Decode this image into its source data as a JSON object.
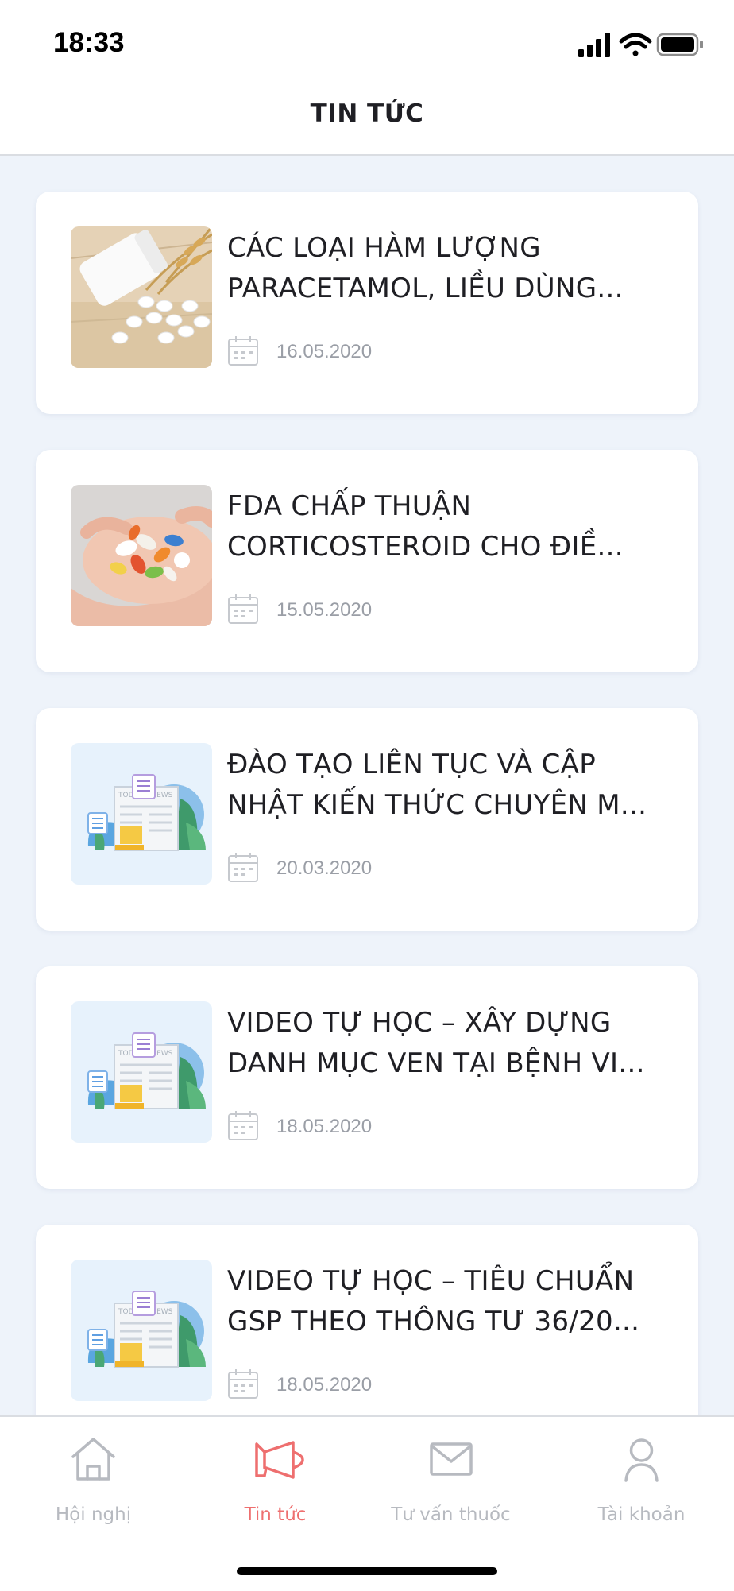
{
  "status_bar": {
    "time": "18:33"
  },
  "header": {
    "title": "TIN TỨC"
  },
  "news": [
    {
      "title_line1": "CÁC LOẠI HÀM LƯỢNG",
      "title_line2": "PARACETAMOL, LIỀU DÙNG...",
      "date": "16.05.2020",
      "thumbnail": "paracetamol-pills-photo"
    },
    {
      "title_line1": "FDA CHẤP THUẬN",
      "title_line2": "CORTICOSTEROID CHO ĐIỀ...",
      "date": "15.05.2020",
      "thumbnail": "hand-with-pills-photo"
    },
    {
      "title_line1": "ĐÀO TẠO LIÊN TỤC VÀ CẬP",
      "title_line2": "NHẬT KIẾN THỨC CHUYÊN M...",
      "date": "20.03.2020",
      "thumbnail": "newspaper-illustration"
    },
    {
      "title_line1": "VIDEO TỰ HỌC – XÂY DỰNG",
      "title_line2": "DANH MỤC VEN TẠI BỆNH VI...",
      "date": "18.05.2020",
      "thumbnail": "newspaper-illustration"
    },
    {
      "title_line1": "VIDEO TỰ HỌC – TIÊU CHUẨN",
      "title_line2": "GSP THEO THÔNG TƯ 36/20...",
      "date": "18.05.2020",
      "thumbnail": "newspaper-illustration"
    }
  ],
  "illustration_text": "TODAY'S NEWS",
  "tabs": [
    {
      "label": "Hội nghị",
      "icon": "home-icon",
      "active": false
    },
    {
      "label": "Tin tức",
      "icon": "megaphone-icon",
      "active": true
    },
    {
      "label": "Tư vấn thuốc",
      "icon": "envelope-icon",
      "active": false
    },
    {
      "label": "Tài khoản",
      "icon": "user-icon",
      "active": false
    }
  ],
  "colors": {
    "accent": "#ee6f6f",
    "inactive": "#b7bac0",
    "background": "#eef3fa"
  }
}
